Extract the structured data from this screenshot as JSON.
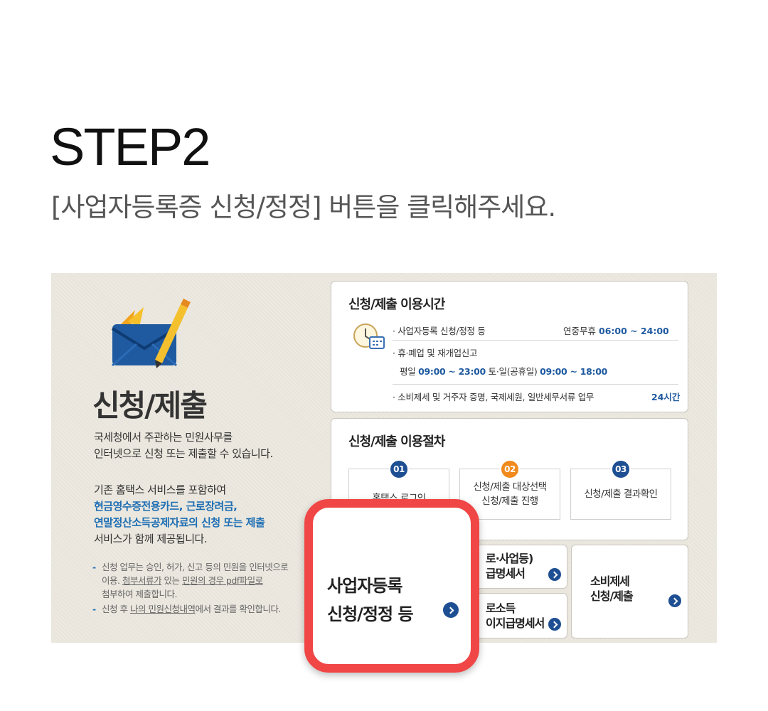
{
  "step": {
    "title": "STEP2",
    "subtitle": "[사업자등록증 신청/정정] 버튼을 클릭해주세요."
  },
  "left": {
    "title": "신청/제출",
    "intro": [
      "국세청에서 주관하는 민원사무를",
      "인터넷으로 신청 또는 제출할 수 있습니다."
    ],
    "service_lead": "기존 홈택스 서비스를 포함하여",
    "service_highlight_1": "현금영수증전용카드, 근로장려금,",
    "service_highlight_2": "연말정산소득공제자료의 신청 또는 제출",
    "service_tail": "서비스가 함께 제공됩니다.",
    "note1_a": "신청 업무는 승인, 허가, 신고 등의 민원을 인터넷으로",
    "note1_b_prefix": "이용.",
    "note1_b_u1": "첨부서류가",
    "note1_b_mid": "있는",
    "note1_b_u2": "민원의 경우 pdf파일로",
    "note1_c": "첨부하여 제출합니다.",
    "note2_prefix": "신청 후",
    "note2_link": "나의 민원신청내역",
    "note2_suffix": "에서 결과를 확인합니다."
  },
  "hours": {
    "title": "신청/제출 이용시간",
    "row1_label": "· 사업자등록 신청/정정 등",
    "row1_prefix": "연중무휴",
    "row1_time": "06:00 ~ 24:00",
    "row2_label": "· 휴·폐업 및 재개업신고",
    "row3_weekday": "평일",
    "row3_weekday_time": "09:00 ~ 23:00",
    "row3_weekend": "토·일(공휴일)",
    "row3_weekend_time": "09:00 ~ 18:00",
    "row4_label": "· 소비제세 및 거주자 증명, 국제세원, 일반세무서류 업무",
    "row4_time": "24시간"
  },
  "procedure": {
    "title": "신청/제출 이용절차",
    "steps": [
      {
        "num": "01",
        "label": "홈택스 로그인",
        "color": "#1e4f93"
      },
      {
        "num": "02",
        "label_1": "신청/제출 대상선택",
        "label_2": "신청/제출 진행",
        "color": "#f08a1c"
      },
      {
        "num": "03",
        "label": "신청/제출 결과확인",
        "color": "#1e4f93"
      }
    ]
  },
  "tiles": {
    "middle_top_1": "로·사업등)",
    "middle_top_2": "급명세서",
    "middle_bottom_1": "로소득",
    "middle_bottom_2": "이지급명세서",
    "right_1": "소비제세",
    "right_2": "신청/제출"
  },
  "callout": {
    "line1": "사업자등록",
    "line2": "신청/정정 등"
  },
  "colors": {
    "accent": "#1e4f93",
    "highlight_border": "#f04646",
    "panel_bg": "#e9e5dc"
  }
}
